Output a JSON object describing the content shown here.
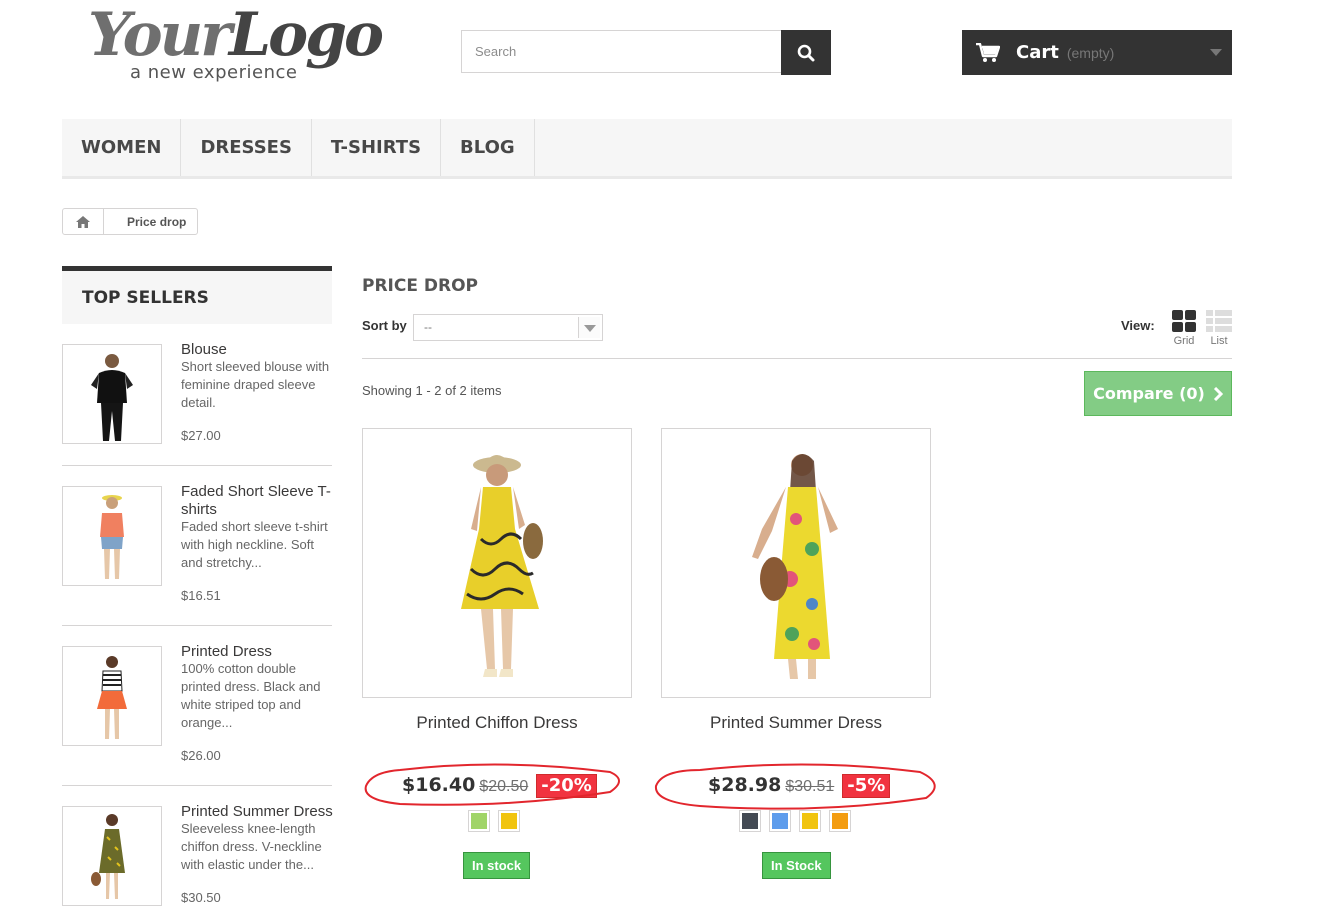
{
  "header": {
    "logo": {
      "word_your": "Your",
      "word_logo": "Logo",
      "tagline": "a new experience"
    },
    "search": {
      "placeholder": "Search",
      "button_icon": "search-icon"
    },
    "cart": {
      "label": "Cart",
      "state": "(empty)",
      "icon": "cart-icon"
    }
  },
  "menu": {
    "items": [
      {
        "label": "WOMEN"
      },
      {
        "label": "DRESSES"
      },
      {
        "label": "T-SHIRTS"
      },
      {
        "label": "BLOG"
      }
    ]
  },
  "breadcrumb": {
    "home_icon": "home-icon",
    "current": "Price drop"
  },
  "sidebar": {
    "title": "TOP SELLERS",
    "items": [
      {
        "name": "Blouse",
        "description": "Short sleeved blouse with feminine draped sleeve detail.",
        "price": "$27.00"
      },
      {
        "name": "Faded Short Sleeve T-shirts",
        "description": "Faded short sleeve t-shirt with high neckline. Soft and stretchy...",
        "price": "$16.51"
      },
      {
        "name": "Printed Dress",
        "description": "100% cotton double printed dress. Black and white striped top and orange...",
        "price": "$26.00"
      },
      {
        "name": "Printed Summer Dress",
        "description": "Sleeveless knee-length chiffon dress. V-neckline with elastic under the...",
        "price": "$30.50"
      }
    ]
  },
  "main": {
    "title": "PRICE DROP",
    "sort": {
      "label": "Sort by",
      "value": "--"
    },
    "view": {
      "label": "View:",
      "grid": "Grid",
      "list": "List"
    },
    "showing": "Showing 1 - 2 of 2 items",
    "compare": "Compare (0)",
    "products": [
      {
        "name": "Printed Chiffon Dress",
        "price": "$16.40",
        "old_price": "$20.50",
        "discount": "-20%",
        "colors": [
          "#a0d468",
          "#f1c40f"
        ],
        "stock": "In stock"
      },
      {
        "name": "Printed Summer Dress",
        "price": "$28.98",
        "old_price": "$30.51",
        "discount": "-5%",
        "colors": [
          "#434a54",
          "#5d9cec",
          "#f1c40f",
          "#f39c11"
        ],
        "stock": "In Stock"
      }
    ]
  },
  "annotation_color": "#e2262d"
}
